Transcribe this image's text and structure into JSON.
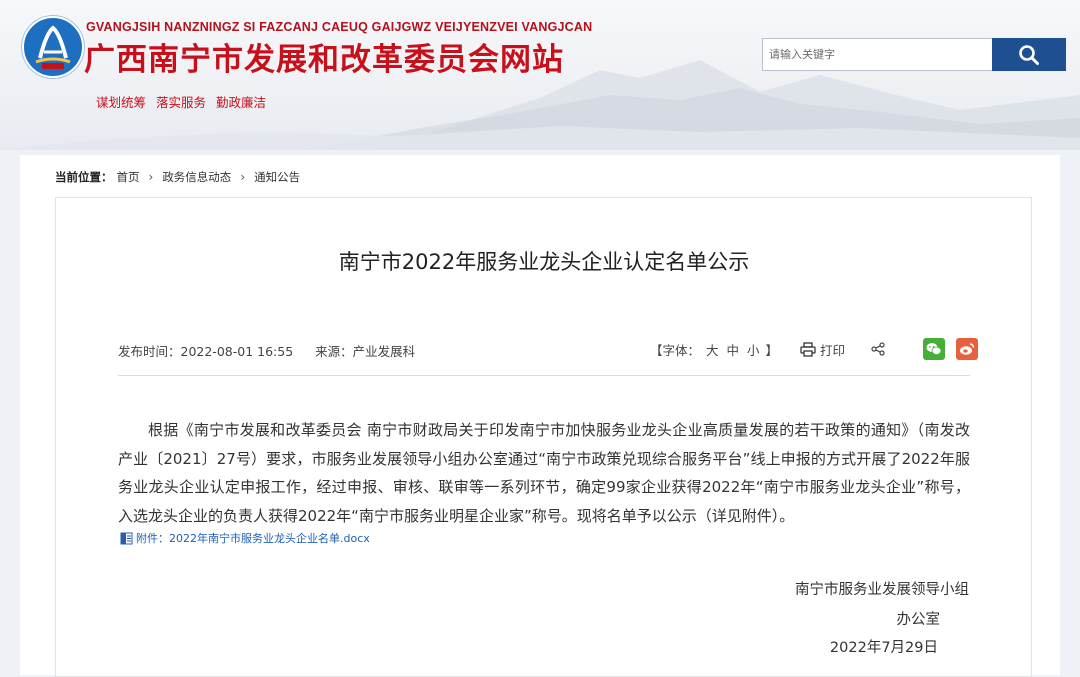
{
  "header": {
    "pinyin": "GVANGJSIH NANZNINGZ SI FAZCANJ CAEUQ GAIJGWZ VEIJYENZVEI VANGJCAN",
    "title": "广西南宁市发展和改革委员会网站",
    "slogans": [
      "谋划统筹",
      "落实服务",
      "勤政廉洁"
    ],
    "logo_icon": "ribbon-logo-icon"
  },
  "search": {
    "placeholder": "请输入关键字",
    "icon": "search-icon"
  },
  "breadcrumb": {
    "label": "当前位置：",
    "items": [
      "首页",
      "政务信息动态",
      "通知公告"
    ]
  },
  "article": {
    "title": "南宁市2022年服务业龙头企业认定名单公示",
    "publish_time": "发布时间：2022-08-01 16:55",
    "source": "来源：产业发展科",
    "font_size_prefix": "【字体：",
    "font_size_options": [
      "大",
      "中",
      "小"
    ],
    "font_size_suffix": "】",
    "print_label": "打印",
    "body": "根据《南宁市发展和改革委员会 南宁市财政局关于印发南宁市加快服务业龙头企业高质量发展的若干政策的通知》（南发改产业〔2021〕27号）要求，市服务业发展领导小组办公室通过“南宁市政策兑现综合服务平台”线上申报的方式开展了2022年服务业龙头企业认定申报工作，经过申报、审核、联审等一系列环节，确定99家企业获得2022年“南宁市服务业龙头企业”称号，入选龙头企业的负责人获得2022年“南宁市服务业明星企业家”称号。现将名单予以公示（详见附件）。",
    "attachment": "附件：2022年南宁市服务业龙头企业名单.docx",
    "signature_org": "南宁市服务业发展领导小组",
    "signature_office": "办公室",
    "signature_date": "2022年7月29日"
  },
  "colors": {
    "brand_red": "#c8101a",
    "search_button": "#1d4f91",
    "link_blue": "#1d5fb8",
    "wechat_green": "#45b035",
    "weibo_orange": "#e8603c"
  }
}
